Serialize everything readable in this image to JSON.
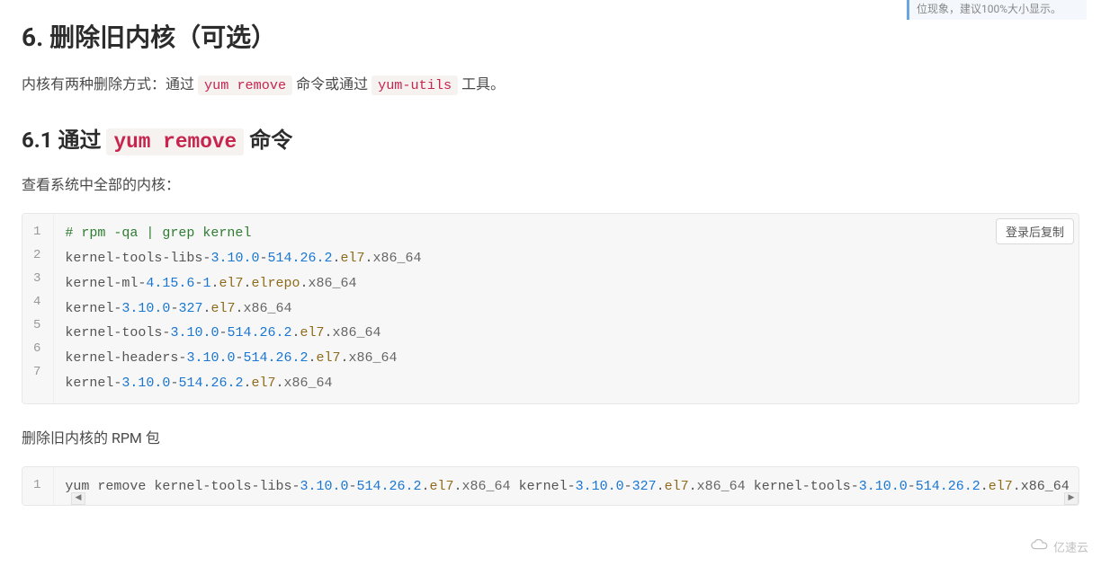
{
  "top_note": "位现象，建议100%大小显示。",
  "h2": "6. 删除旧内核（可选）",
  "p1_pre": "内核有两种删除方式：通过 ",
  "p1_code1": "yum remove",
  "p1_mid": " 命令或通过 ",
  "p1_code2": "yum-utils",
  "p1_post": " 工具。",
  "h3_pre": "6.1 通过 ",
  "h3_code": "yum remove",
  "h3_post": " 命令",
  "p2": "查看系统中全部的内核：",
  "copy_btn": "登录后复制",
  "block1": {
    "line1_comment": "# rpm -qa | grep kernel",
    "line2_a": "kernel-tools-libs-",
    "line2_ver": "3.10.0",
    "line2_dash": "-",
    "line2_ver2": "514.26.2",
    "line2_dot": ".",
    "line2_el": "el7",
    "line2_dot2": ".",
    "line2_arch": "x86_64",
    "line3_a": "kernel-ml-",
    "line3_ver": "4.15.6",
    "line3_dash": "-",
    "line3_ver2": "1",
    "line3_dot": ".",
    "line3_el": "el7",
    "line3_dot2": ".",
    "line3_rep": "elrepo",
    "line3_dot3": ".",
    "line3_arch": "x86_64",
    "line4_a": "kernel-",
    "line4_ver": "3.10.0",
    "line4_dash": "-",
    "line4_ver2": "327",
    "line4_dot": ".",
    "line4_el": "el7",
    "line4_dot2": ".",
    "line4_arch": "x86_64",
    "line5_a": "kernel-tools-",
    "line5_ver": "3.10.0",
    "line5_dash": "-",
    "line5_ver2": "514.26.2",
    "line5_dot": ".",
    "line5_el": "el7",
    "line5_dot2": ".",
    "line5_arch": "x86_64",
    "line6_a": "kernel-headers-",
    "line6_ver": "3.10.0",
    "line6_dash": "-",
    "line6_ver2": "514.26.2",
    "line6_dot": ".",
    "line6_el": "el7",
    "line6_dot2": ".",
    "line6_arch": "x86_64",
    "line7_a": "kernel-",
    "line7_ver": "3.10.0",
    "line7_dash": "-",
    "line7_ver2": "514.26.2",
    "line7_dot": ".",
    "line7_el": "el7",
    "line7_dot2": ".",
    "line7_arch": "x86_64",
    "ln1": "1",
    "ln2": "2",
    "ln3": "3",
    "ln4": "4",
    "ln5": "5",
    "ln6": "6",
    "ln7": "7"
  },
  "p3": "删除旧内核的 RPM 包",
  "block2": {
    "ln1": "1",
    "cmd_pre": "yum remove kernel-tools-libs-",
    "v1": "3.10.0",
    "d1": "-",
    "v2": "514.26.2",
    "dot1": ".",
    "el1": "el7",
    "dot1b": ".",
    "arch1": "x86_64",
    "sp1": " kernel-",
    "v3": "3.10.0",
    "d2": "-",
    "v4": "327",
    "dot2": ".",
    "el2": "el7",
    "dot2b": ".",
    "arch2": "x86_64",
    "sp2": " kernel-tools-",
    "v5": "3.10.0",
    "d3": "-",
    "v6": "514.26.2",
    "dot3": ".",
    "el3": "el7"
  },
  "brand": "亿速云"
}
